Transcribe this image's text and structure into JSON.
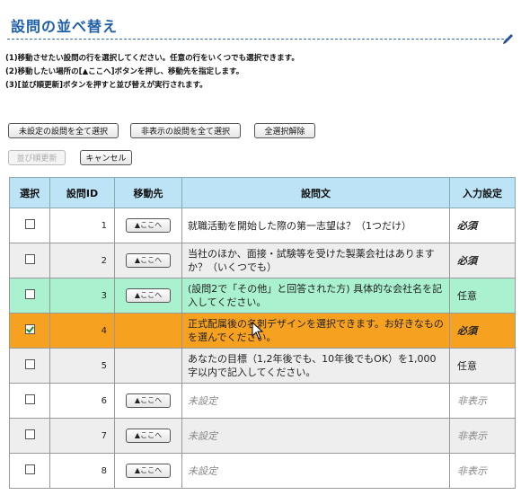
{
  "page": {
    "title": "設問の並べ替え",
    "instructions": [
      "(1)移動させたい設問の行を選択してください。任意の行をいくつでも選択できます。",
      "(2)移動したい場所の[▲ここへ]ボタンを押し、移動先を指定します。",
      "(3)[並び順更新]ボタンを押すと並び替えが実行されます。"
    ]
  },
  "toolbar": {
    "select_unset": "未設定の設問を全て選択",
    "select_hidden": "非表示の設問を全て選択",
    "clear_selection": "全選択解除",
    "update_order": "並び順更新",
    "cancel": "キャンセル"
  },
  "table": {
    "headers": [
      "選択",
      "設問ID",
      "移動先",
      "設問文",
      "入力設定"
    ],
    "here_label": "▲ここへ",
    "rows": [
      {
        "id": "1",
        "text": "就職活動を開始した際の第一志望は？（1つだけ）",
        "input": "必須",
        "checked": false,
        "style": "white",
        "has_move": true,
        "kind": "req"
      },
      {
        "id": "2",
        "text": "当社のほか、面接・試験等を受けた製薬会社はありますか？（いくつでも）",
        "input": "必須",
        "checked": false,
        "style": "grey",
        "has_move": true,
        "kind": "req"
      },
      {
        "id": "3",
        "text": "(設問2で「その他」と回答された方) 具体的な会社名を記入してください。",
        "input": "任意",
        "checked": false,
        "style": "green",
        "has_move": true,
        "kind": "opt"
      },
      {
        "id": "4",
        "text": "正式配属後の名刺デザインを選択できます。お好きなものを選んでください。",
        "input": "必須",
        "checked": true,
        "style": "orange",
        "has_move": false,
        "kind": "req"
      },
      {
        "id": "5",
        "text": "あなたの目標（1,2年後でも、10年後でもOK）を1,000字以内で記入してください。",
        "input": "任意",
        "checked": false,
        "style": "grey",
        "has_move": false,
        "kind": "opt"
      },
      {
        "id": "6",
        "text": "未設定",
        "input": "非表示",
        "checked": false,
        "style": "white",
        "has_move": true,
        "kind": "hidden"
      },
      {
        "id": "7",
        "text": "未設定",
        "input": "非表示",
        "checked": false,
        "style": "grey",
        "has_move": true,
        "kind": "hidden"
      },
      {
        "id": "8",
        "text": "未設定",
        "input": "非表示",
        "checked": false,
        "style": "white",
        "has_move": true,
        "kind": "hidden"
      }
    ]
  },
  "colors": {
    "header_bg": "#bde3f7",
    "selected_row": "#f7a120",
    "hover_row": "#a9f1cf",
    "title": "#1f5fa8"
  }
}
